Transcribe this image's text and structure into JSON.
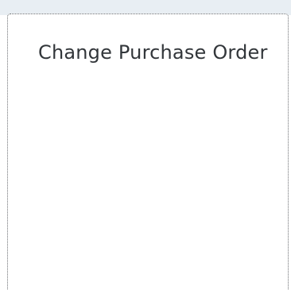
{
  "tile": {
    "title": "Change Purchase Order"
  }
}
